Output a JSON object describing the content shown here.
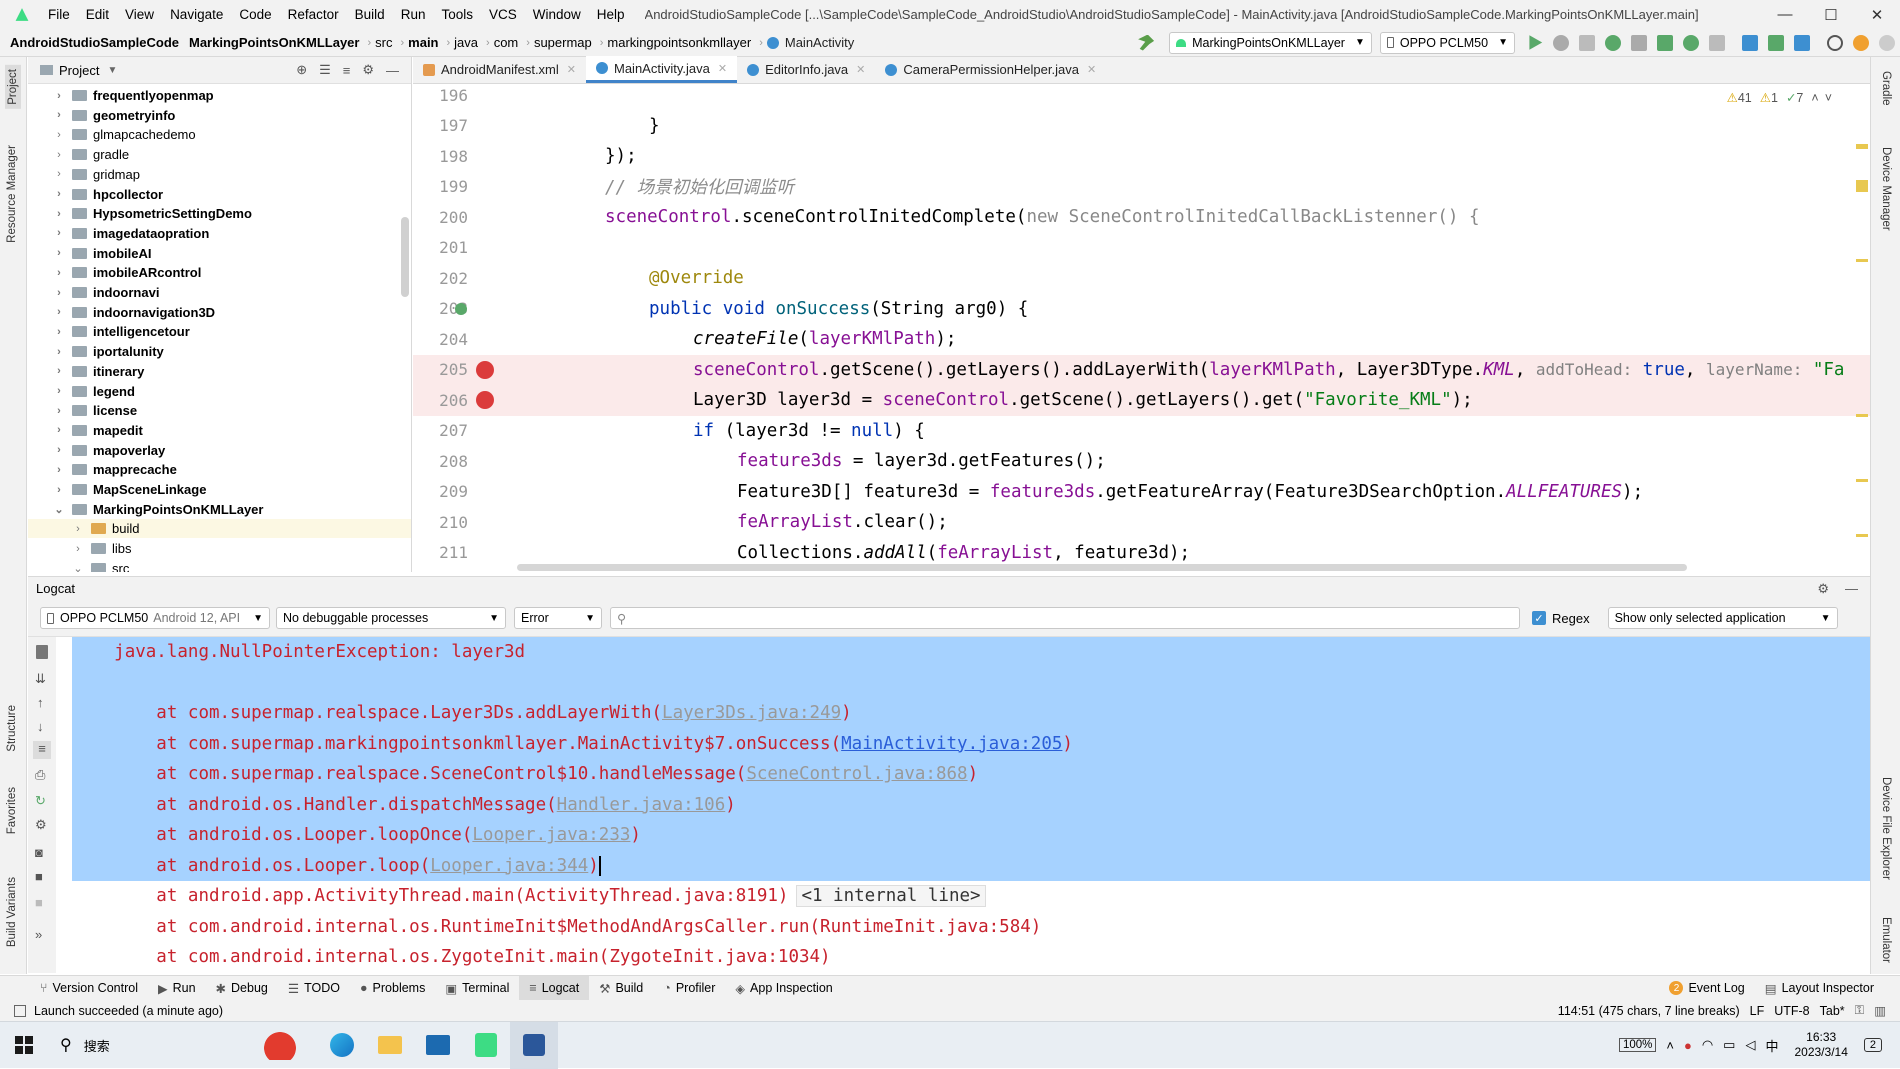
{
  "titlebar": {
    "menu": [
      "File",
      "Edit",
      "View",
      "Navigate",
      "Code",
      "Refactor",
      "Build",
      "Run",
      "Tools",
      "VCS",
      "Window",
      "Help"
    ],
    "window_title": "AndroidStudioSampleCode [...\\SampleCode\\SampleCode_AndroidStudio\\AndroidStudioSampleCode] - MainActivity.java [AndroidStudioSampleCode.MarkingPointsOnKMLLayer.main]",
    "minimize": "—",
    "maximize": "☐",
    "close": "✕"
  },
  "navbar": {
    "crumbs": [
      "AndroidStudioSampleCode",
      "MarkingPointsOnKMLLayer",
      "src",
      "main",
      "java",
      "com",
      "supermap",
      "markingpointsonkmllayer",
      "MainActivity"
    ],
    "run_config": "MarkingPointsOnKMLLayer",
    "device": "OPPO PCLM50"
  },
  "left_strip": {
    "project": "Project",
    "resource_manager": "Resource Manager",
    "structure": "Structure",
    "favorites": "Favorites",
    "build_variants": "Build Variants"
  },
  "right_strip": {
    "gradle": "Gradle",
    "device_manager": "Device Manager",
    "device_file_explorer": "Device File Explorer",
    "emulator": "Emulator"
  },
  "project": {
    "header": "Project",
    "items": [
      {
        "label": "frequentlyopenmap",
        "bold": true
      },
      {
        "label": "geometryinfo",
        "bold": true
      },
      {
        "label": "glmapcachedemo",
        "bold": false
      },
      {
        "label": "gradle",
        "bold": false
      },
      {
        "label": "gridmap",
        "bold": false
      },
      {
        "label": "hpcollector",
        "bold": true
      },
      {
        "label": "HypsometricSettingDemo",
        "bold": true
      },
      {
        "label": "imagedataopration",
        "bold": true
      },
      {
        "label": "imobileAI",
        "bold": true
      },
      {
        "label": "imobileARcontrol",
        "bold": true
      },
      {
        "label": "indoornavi",
        "bold": true
      },
      {
        "label": "indoornavigation3D",
        "bold": true
      },
      {
        "label": "intelligencetour",
        "bold": true
      },
      {
        "label": "iportalunity",
        "bold": true
      },
      {
        "label": "itinerary",
        "bold": true
      },
      {
        "label": "legend",
        "bold": true
      },
      {
        "label": "license",
        "bold": true
      },
      {
        "label": "mapedit",
        "bold": true
      },
      {
        "label": "mapoverlay",
        "bold": true
      },
      {
        "label": "mapprecache",
        "bold": true
      },
      {
        "label": "MapSceneLinkage",
        "bold": true
      },
      {
        "label": "MarkingPointsOnKMLLayer",
        "bold": true
      },
      {
        "label": "build",
        "bold": false
      },
      {
        "label": "libs",
        "bold": false
      },
      {
        "label": "src",
        "bold": false
      }
    ]
  },
  "editor_tabs": [
    {
      "label": "AndroidManifest.xml",
      "active": false
    },
    {
      "label": "MainActivity.java",
      "active": true
    },
    {
      "label": "EditorInfo.java",
      "active": false
    },
    {
      "label": "CameraPermissionHelper.java",
      "active": false
    }
  ],
  "inspections": {
    "warnings": "41",
    "weak": "1",
    "ok": "7"
  },
  "code": {
    "line_numbers": [
      "196",
      "197",
      "198",
      "199",
      "200",
      "201",
      "202",
      "203",
      "204",
      "205",
      "206",
      "207",
      "208",
      "209",
      "210",
      "211"
    ],
    "l197": "}",
    "l198": "});",
    "l199": "// 场景初始化回调监听",
    "l200_a": "sceneControl",
    "l200_b": ".sceneControlInitedComplete(",
    "l200_c": "new ",
    "l200_d": "SceneControlInitedCallBackListenner() {",
    "l202": "@Override",
    "l203_a": "public void ",
    "l203_b": "onSuccess",
    "l203_c": "(String arg0) {",
    "l204_a": "createFile",
    "l204_b": "(",
    "l204_c": "layerKMlPath",
    "l204_d": ");",
    "l205_a": "sceneControl",
    "l205_b": ".getScene().getLayers().addLayerWith(",
    "l205_c": "layerKMlPath",
    "l205_d": ", Layer3DType.",
    "l205_e": "KML",
    "l205_f": ", ",
    "l205_hint1": "addToHead:",
    "l205_true": " true",
    "l205_g": ", ",
    "l205_hint2": "layerName:",
    "l205_h": " \"Fa",
    "l206_a": "Layer3D layer3d = ",
    "l206_b": "sceneControl",
    "l206_c": ".getScene().getLayers().get(",
    "l206_d": "\"Favorite_KML\"",
    "l206_e": ");",
    "l207_a": "if ",
    "l207_b": "(layer3d != ",
    "l207_c": "null",
    "l207_d": ") {",
    "l208_a": "feature3ds",
    "l208_b": " = layer3d.getFeatures();",
    "l209_a": "Feature3D[] feature3d = ",
    "l209_b": "feature3ds",
    "l209_c": ".getFeatureArray(Feature3DSearchOption.",
    "l209_d": "ALLFEATURES",
    "l209_e": ");",
    "l210_a": "feArrayList",
    "l210_b": ".clear();",
    "l211_a": "Collections.",
    "l211_b": "addAll",
    "l211_c": "(",
    "l211_d": "feArrayList",
    "l211_e": ", feature3d);"
  },
  "logcat": {
    "title": "Logcat",
    "device": "OPPO PCLM50",
    "device_suffix": "Android 12, API",
    "process": "No debuggable processes",
    "level": "Error",
    "search_placeholder": "",
    "regex_label": "Regex",
    "filter": "Show only selected application",
    "lines": [
      {
        "indent": "    ",
        "text": "java.lang.NullPointerException: layer3d",
        "link": "",
        "after": "",
        "sel": true
      },
      {
        "indent": "",
        "text": "",
        "link": "",
        "after": "",
        "sel": true
      },
      {
        "indent": "        ",
        "text": "at com.supermap.realspace.Layer3Ds.addLayerWith(",
        "link": "Layer3Ds.java:249",
        "after": ")",
        "sel": true
      },
      {
        "indent": "        ",
        "text": "at com.supermap.markingpointsonkmllayer.MainActivity$7.onSuccess(",
        "link": "MainActivity.java:205",
        "after": ")",
        "sel": true
      },
      {
        "indent": "        ",
        "text": "at com.supermap.realspace.SceneControl$10.handleMessage(",
        "link": "SceneControl.java:868",
        "after": ")",
        "sel": true
      },
      {
        "indent": "        ",
        "text": "at android.os.Handler.dispatchMessage(",
        "link": "Handler.java:106",
        "after": ")",
        "sel": true
      },
      {
        "indent": "        ",
        "text": "at android.os.Looper.loopOnce(",
        "link": "Looper.java:233",
        "after": ")",
        "sel": true
      },
      {
        "indent": "        ",
        "text": "at android.os.Looper.loop(",
        "link": "Looper.java:344",
        "after": ")",
        "sel": true
      },
      {
        "indent": "        ",
        "text": "at android.app.ActivityThread.main(ActivityThread.java:8191)",
        "link": "",
        "after": "",
        "tag": "<1 internal line>",
        "sel": false
      },
      {
        "indent": "        ",
        "text": "at com.android.internal.os.RuntimeInit$MethodAndArgsCaller.run(RuntimeInit.java:584)",
        "link": "",
        "after": "",
        "sel": false
      },
      {
        "indent": "        ",
        "text": "at com.android.internal.os.ZygoteInit.main(ZygoteInit.java:1034)",
        "link": "",
        "after": "",
        "sel": false
      }
    ]
  },
  "bottom_tabs": [
    "Version Control",
    "Run",
    "Debug",
    "TODO",
    "Problems",
    "Terminal",
    "Logcat",
    "Build",
    "Profiler",
    "App Inspection"
  ],
  "bottom_right": {
    "event_log": "Event Log",
    "event_count": "2",
    "layout_inspector": "Layout Inspector"
  },
  "status": {
    "message": "Launch succeeded (a minute ago)",
    "position": "114:51 (475 chars, 7 line breaks)",
    "line_sep": "LF",
    "encoding": "UTF-8",
    "indent": "Tab*"
  },
  "taskbar": {
    "search": "搜索",
    "battery": "100%",
    "ime": "中",
    "time": "16:33",
    "date": "2023/3/14",
    "notif": "2"
  },
  "colors": {
    "accent": "#4083c9",
    "selection": "#a6d2ff",
    "error_text": "#c7222d",
    "breakpoint": "#db3b3b"
  }
}
